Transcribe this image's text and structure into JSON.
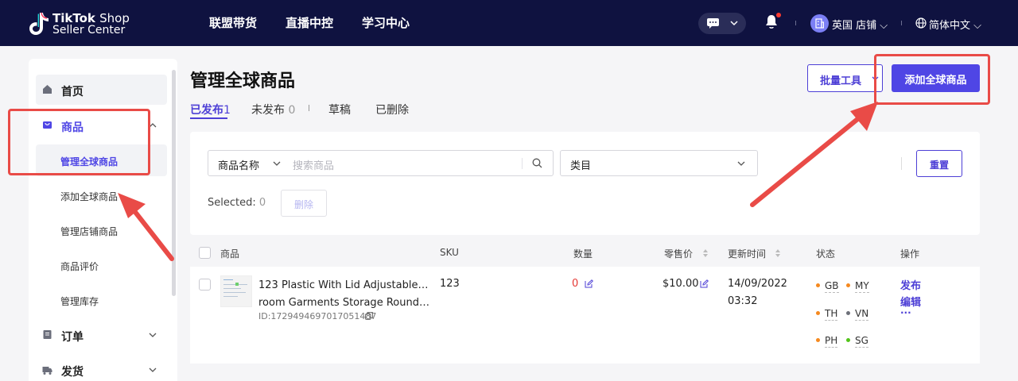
{
  "brand": {
    "line1_bold": "TikTok",
    "line1_light": "Shop",
    "line2": "Seller Center"
  },
  "nav": [
    "联盟带货",
    "直播中控",
    "学习中心"
  ],
  "header": {
    "store": "英国 店铺",
    "language": "简体中文"
  },
  "sidebar": {
    "home": "首页",
    "products": "商品",
    "product_subs": [
      "管理全球商品",
      "添加全球商品",
      "管理店铺商品",
      "商品评价",
      "管理库存"
    ],
    "orders": "订单",
    "shipping": "发货"
  },
  "page": {
    "title": "管理全球商品",
    "tabs": [
      {
        "label": "已发布",
        "count": "1"
      },
      {
        "label": "未发布",
        "count": "0"
      },
      {
        "label": "草稿",
        "count": ""
      },
      {
        "label": "已删除",
        "count": ""
      }
    ],
    "bulk_label": "批量工具",
    "add_label": "添加全球商品"
  },
  "filter": {
    "search_field": "商品名称",
    "search_placeholder": "搜索商品",
    "category": "类目",
    "reset": "重置",
    "selected_label": "Selected:",
    "selected_count": "0",
    "delete": "删除"
  },
  "table": {
    "headers": [
      "商品",
      "SKU",
      "数量",
      "零售价",
      "更新时间",
      "状态",
      "操作"
    ],
    "row": {
      "name_line1": "123 Plastic With Lid Adjustable Bed",
      "name_line2": "room Garments Storage Round B...",
      "id": "ID:1729494697017051487",
      "sku": "123",
      "quantity": "0",
      "price": "$10.00",
      "date": "14/09/2022",
      "time": "03:32",
      "statuses": [
        {
          "code": "GB",
          "color": "#f5891f"
        },
        {
          "code": "MY",
          "color": "#f5891f"
        },
        {
          "code": "TH",
          "color": "#f5891f"
        },
        {
          "code": "VN",
          "color": "#6d7079"
        },
        {
          "code": "PH",
          "color": "#f5891f"
        },
        {
          "code": "SG",
          "color": "#52c41a"
        }
      ],
      "actions": [
        "发布",
        "编辑",
        "..."
      ]
    }
  },
  "colors": {
    "topbar": "#0f1240",
    "accent": "#4f46e5",
    "annotation": "#e94b47"
  }
}
